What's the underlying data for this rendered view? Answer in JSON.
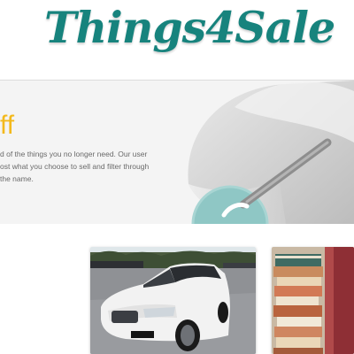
{
  "site": {
    "logo_text": "Things4Sale"
  },
  "hero": {
    "title": "ff",
    "text_lines": [
      "d of the things you no longer need. Our user",
      "ost what you choose to sell and filter through",
      "the name."
    ]
  },
  "listings": [
    {
      "image": "white-sedan-photo"
    },
    {
      "image": "stacked-books-photo"
    }
  ],
  "colors": {
    "brand": "#17837d",
    "accent": "#f3b91c",
    "hero_bg": "#f4f4f4"
  }
}
